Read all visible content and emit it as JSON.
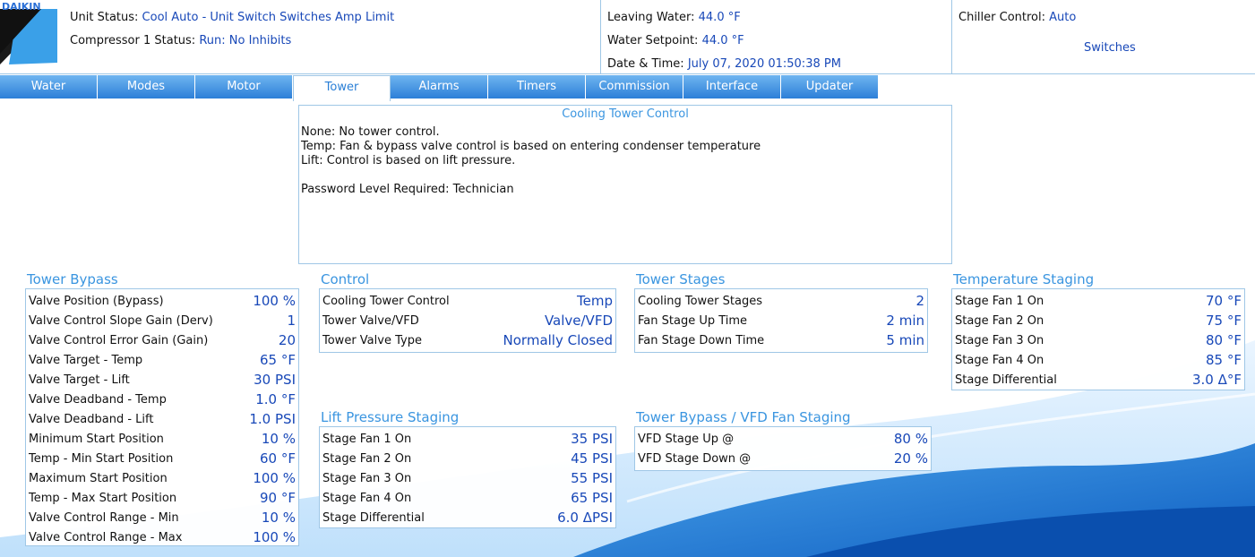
{
  "header": {
    "logo_text": "DAIKIN",
    "unit_status_label": "Unit Status:",
    "unit_status_value": "Cool Auto - Unit Switch  Switches Amp Limit",
    "compressor_label": "Compressor 1 Status:",
    "compressor_value": "Run: No Inhibits",
    "leaving_water_label": "Leaving Water:",
    "leaving_water_value": "44.0 °F",
    "water_setpoint_label": "Water Setpoint:",
    "water_setpoint_value": "44.0 °F",
    "datetime_label": "Date & Time:",
    "datetime_value": "July 07, 2020  01:50:38 PM",
    "chiller_control_label": "Chiller Control:",
    "chiller_control_value": "Auto",
    "switches_label": "Switches"
  },
  "tabs": [
    {
      "label": "Water",
      "width": 109
    },
    {
      "label": "Modes",
      "width": 109
    },
    {
      "label": "Motor",
      "width": 109
    },
    {
      "label": "Tower",
      "width": 109
    },
    {
      "label": "Alarms",
      "width": 109
    },
    {
      "label": "Timers",
      "width": 109
    },
    {
      "label": "Commission",
      "width": 109
    },
    {
      "label": "Interface",
      "width": 109
    },
    {
      "label": "Updater",
      "width": 109
    }
  ],
  "active_tab": "Tower",
  "info": {
    "title": "Cooling Tower Control",
    "lines": [
      "None: No tower control.",
      "Temp: Fan & bypass valve control is based on entering condenser temperature",
      "Lift: Control is based on lift pressure.",
      "",
      "Password Level Required: Technician"
    ]
  },
  "tower_bypass": {
    "title": "Tower Bypass",
    "rows": [
      {
        "label": "Valve Position (Bypass)",
        "value": "100 %"
      },
      {
        "label": "Valve Control Slope Gain (Derv)",
        "value": "1"
      },
      {
        "label": "Valve Control Error Gain (Gain)",
        "value": "20"
      },
      {
        "label": "Valve Target - Temp",
        "value": "65 °F"
      },
      {
        "label": "Valve Target - Lift",
        "value": "30 PSI"
      },
      {
        "label": "Valve Deadband - Temp",
        "value": "1.0 °F"
      },
      {
        "label": "Valve Deadband - Lift",
        "value": "1.0 PSI"
      },
      {
        "label": "Minimum Start Position",
        "value": "10 %"
      },
      {
        "label": "Temp - Min Start Position",
        "value": "60 °F"
      },
      {
        "label": "Maximum Start Position",
        "value": "100 %"
      },
      {
        "label": "Temp - Max Start Position",
        "value": "90 °F"
      },
      {
        "label": "Valve Control Range - Min",
        "value": "10 %"
      },
      {
        "label": "Valve Control Range - Max",
        "value": "100 %"
      }
    ]
  },
  "control": {
    "title": "Control",
    "rows": [
      {
        "label": "Cooling Tower Control",
        "value": "Temp"
      },
      {
        "label": "Tower Valve/VFD",
        "value": "Valve/VFD"
      },
      {
        "label": "Tower Valve Type",
        "value": "Normally Closed"
      }
    ]
  },
  "tower_stages": {
    "title": "Tower Stages",
    "rows": [
      {
        "label": "Cooling Tower Stages",
        "value": "2"
      },
      {
        "label": "Fan Stage Up Time",
        "value": "2 min"
      },
      {
        "label": "Fan Stage Down Time",
        "value": "5 min"
      }
    ]
  },
  "temperature_staging": {
    "title": "Temperature Staging",
    "rows": [
      {
        "label": "Stage Fan 1 On",
        "value": "70 °F"
      },
      {
        "label": "Stage Fan 2 On",
        "value": "75 °F"
      },
      {
        "label": "Stage Fan 3 On",
        "value": "80 °F"
      },
      {
        "label": "Stage Fan 4 On",
        "value": "85 °F"
      },
      {
        "label": "Stage Differential",
        "value": "3.0 Δ°F"
      }
    ]
  },
  "lift_pressure_staging": {
    "title": "Lift Pressure Staging",
    "rows": [
      {
        "label": "Stage Fan 1 On",
        "value": "35 PSI"
      },
      {
        "label": "Stage Fan 2 On",
        "value": "45 PSI"
      },
      {
        "label": "Stage Fan 3 On",
        "value": "55 PSI"
      },
      {
        "label": "Stage Fan 4 On",
        "value": "65 PSI"
      },
      {
        "label": "Stage Differential",
        "value": "6.0 ΔPSI"
      }
    ]
  },
  "vfd_fan_staging": {
    "title": "Tower Bypass / VFD Fan Staging",
    "rows": [
      {
        "label": "VFD Stage Up @",
        "value": "80 %"
      },
      {
        "label": "VFD Stage Down @",
        "value": "20 %"
      }
    ]
  },
  "colors": {
    "accent": "#3a95e0",
    "value_text": "#1848b8",
    "tab_gradient_top": "#6fb5f0",
    "tab_gradient_bottom": "#2c7fd8",
    "border": "#9fc7e6"
  }
}
